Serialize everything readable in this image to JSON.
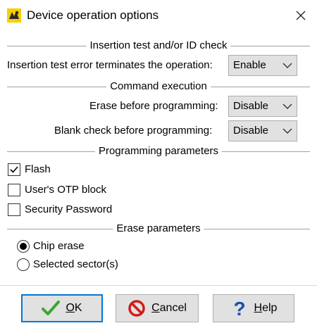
{
  "window": {
    "title": "Device operation options",
    "icon": "app-logo-icon",
    "close_icon": "close-icon"
  },
  "groups": {
    "insertion": {
      "header": "Insertion test and/or ID check",
      "error_terminates_label": "Insertion test error terminates the operation:",
      "error_terminates_value": "Enable"
    },
    "command": {
      "header": "Command execution",
      "erase_label": "Erase before programming:",
      "erase_value": "Disable",
      "blank_label": "Blank check before programming:",
      "blank_value": "Disable"
    },
    "programming": {
      "header": "Programming parameters",
      "items": [
        {
          "label": "Flash",
          "checked": true
        },
        {
          "label": "User's OTP block",
          "checked": false
        },
        {
          "label": "Security Password",
          "checked": false
        }
      ]
    },
    "erase": {
      "header": "Erase parameters",
      "options": [
        {
          "label": "Chip erase",
          "selected": true
        },
        {
          "label": "Selected sector(s)",
          "selected": false
        }
      ]
    }
  },
  "buttons": {
    "ok": {
      "label_accel": "O",
      "label_rest": "K",
      "icon": "checkmark-icon"
    },
    "cancel": {
      "label_accel": "C",
      "label_rest": "ancel",
      "icon": "cancel-icon"
    },
    "help": {
      "label_accel": "H",
      "label_rest": "elp",
      "icon": "help-icon"
    }
  },
  "colors": {
    "accent": "#0078d7",
    "ok_green": "#3aa832",
    "cancel_red": "#d11b1b",
    "help_blue": "#1e4bb3"
  }
}
